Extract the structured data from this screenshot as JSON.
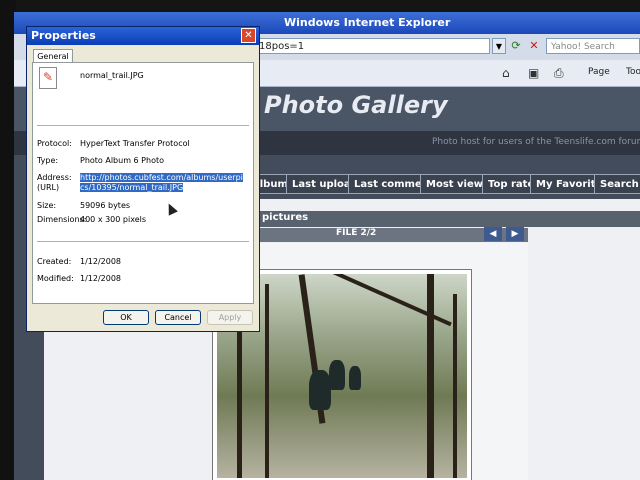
{
  "browser": {
    "title": "Windows Internet Explorer",
    "address_value": "18pos=1",
    "search_placeholder": "Yahoo! Search",
    "toolbar": {
      "page_label": "Page",
      "tools_label": "Tools"
    }
  },
  "page": {
    "site_title": "Photo Gallery",
    "tagline": "Photo host for users of the Teenslife.com forum",
    "nav": [
      "Album list",
      "Last uploads",
      "Last comments",
      "Most viewed",
      "Top rated",
      "My Favorites",
      "Search"
    ],
    "section_title": "pictures",
    "file_counter": "FILE 2/2"
  },
  "dialog": {
    "title": "Properties",
    "tab": "General",
    "file_name": "normal_trail.JPG",
    "protocol_label": "Protocol:",
    "protocol_value": "HyperText Transfer Protocol",
    "type_label": "Type:",
    "type_value": "Photo Album 6 Photo",
    "address_label": "Address:",
    "address_label2": "(URL)",
    "address_value": "http://photos.cubfest.com/albums/userpics/10395/normal_trail.JPG",
    "size_label": "Size:",
    "size_value": "59096 bytes",
    "dimensions_label": "Dimensions:",
    "dimensions_value": "400 x 300 pixels",
    "created_label": "Created:",
    "created_value": "1/12/2008",
    "modified_label": "Modified:",
    "modified_value": "1/12/2008",
    "buttons": {
      "ok": "OK",
      "cancel": "Cancel",
      "apply": "Apply"
    }
  },
  "colors": {
    "ie_title": "#1c48b8",
    "nav_button": "#3a4250",
    "selection": "#316ac5",
    "close_button": "#d9462a"
  }
}
